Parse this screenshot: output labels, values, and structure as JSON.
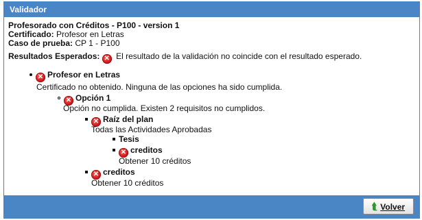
{
  "window": {
    "title": "Validador"
  },
  "header": {
    "plan": "Profesorado con Créditos - P100 - version 1",
    "certificado_label": "Certificado:",
    "certificado_value": "Profesor en Letras",
    "caso_label": "Caso de prueba:",
    "caso_value": "CP 1 - P100",
    "resultados_label": "Resultados Esperados:",
    "resultados_value": "El resultado de la validación no coincide con el resultado esperado."
  },
  "tree": {
    "profesor": {
      "label": "Profesor en Letras",
      "desc": "Certificado no obtenido. Ninguna de las opciones ha sido cumplida."
    },
    "opcion": {
      "label": "Opción 1",
      "desc": "Opción no cumplida. Existen 2 requisitos no cumplidos."
    },
    "raiz": {
      "label": "Raíz del plan",
      "desc": "Todas las Actividades Aprobadas"
    },
    "tesis": {
      "label": "Tesis"
    },
    "creditos_inner": {
      "label": "creditos",
      "desc": "Obtener 10 créditos"
    },
    "creditos_outer": {
      "label": "creditos",
      "desc": "Obtener 10 créditos"
    }
  },
  "footer": {
    "volver_label": "Volver"
  },
  "colors": {
    "accent": "#4a86c6",
    "error": "#d0141d"
  }
}
